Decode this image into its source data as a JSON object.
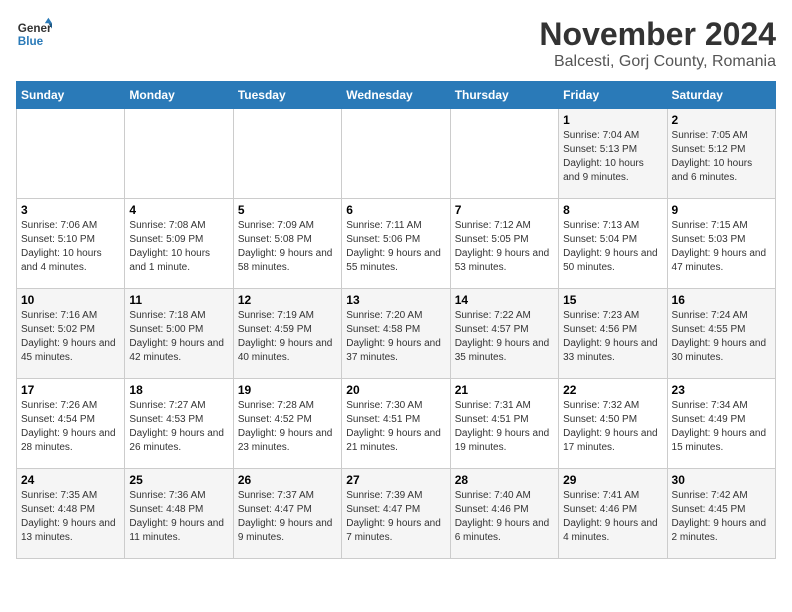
{
  "logo": {
    "line1": "General",
    "line2": "Blue"
  },
  "title": "November 2024",
  "subtitle": "Balcesti, Gorj County, Romania",
  "weekdays": [
    "Sunday",
    "Monday",
    "Tuesday",
    "Wednesday",
    "Thursday",
    "Friday",
    "Saturday"
  ],
  "weeks": [
    [
      {
        "day": "",
        "info": ""
      },
      {
        "day": "",
        "info": ""
      },
      {
        "day": "",
        "info": ""
      },
      {
        "day": "",
        "info": ""
      },
      {
        "day": "",
        "info": ""
      },
      {
        "day": "1",
        "info": "Sunrise: 7:04 AM\nSunset: 5:13 PM\nDaylight: 10 hours and 9 minutes."
      },
      {
        "day": "2",
        "info": "Sunrise: 7:05 AM\nSunset: 5:12 PM\nDaylight: 10 hours and 6 minutes."
      }
    ],
    [
      {
        "day": "3",
        "info": "Sunrise: 7:06 AM\nSunset: 5:10 PM\nDaylight: 10 hours and 4 minutes."
      },
      {
        "day": "4",
        "info": "Sunrise: 7:08 AM\nSunset: 5:09 PM\nDaylight: 10 hours and 1 minute."
      },
      {
        "day": "5",
        "info": "Sunrise: 7:09 AM\nSunset: 5:08 PM\nDaylight: 9 hours and 58 minutes."
      },
      {
        "day": "6",
        "info": "Sunrise: 7:11 AM\nSunset: 5:06 PM\nDaylight: 9 hours and 55 minutes."
      },
      {
        "day": "7",
        "info": "Sunrise: 7:12 AM\nSunset: 5:05 PM\nDaylight: 9 hours and 53 minutes."
      },
      {
        "day": "8",
        "info": "Sunrise: 7:13 AM\nSunset: 5:04 PM\nDaylight: 9 hours and 50 minutes."
      },
      {
        "day": "9",
        "info": "Sunrise: 7:15 AM\nSunset: 5:03 PM\nDaylight: 9 hours and 47 minutes."
      }
    ],
    [
      {
        "day": "10",
        "info": "Sunrise: 7:16 AM\nSunset: 5:02 PM\nDaylight: 9 hours and 45 minutes."
      },
      {
        "day": "11",
        "info": "Sunrise: 7:18 AM\nSunset: 5:00 PM\nDaylight: 9 hours and 42 minutes."
      },
      {
        "day": "12",
        "info": "Sunrise: 7:19 AM\nSunset: 4:59 PM\nDaylight: 9 hours and 40 minutes."
      },
      {
        "day": "13",
        "info": "Sunrise: 7:20 AM\nSunset: 4:58 PM\nDaylight: 9 hours and 37 minutes."
      },
      {
        "day": "14",
        "info": "Sunrise: 7:22 AM\nSunset: 4:57 PM\nDaylight: 9 hours and 35 minutes."
      },
      {
        "day": "15",
        "info": "Sunrise: 7:23 AM\nSunset: 4:56 PM\nDaylight: 9 hours and 33 minutes."
      },
      {
        "day": "16",
        "info": "Sunrise: 7:24 AM\nSunset: 4:55 PM\nDaylight: 9 hours and 30 minutes."
      }
    ],
    [
      {
        "day": "17",
        "info": "Sunrise: 7:26 AM\nSunset: 4:54 PM\nDaylight: 9 hours and 28 minutes."
      },
      {
        "day": "18",
        "info": "Sunrise: 7:27 AM\nSunset: 4:53 PM\nDaylight: 9 hours and 26 minutes."
      },
      {
        "day": "19",
        "info": "Sunrise: 7:28 AM\nSunset: 4:52 PM\nDaylight: 9 hours and 23 minutes."
      },
      {
        "day": "20",
        "info": "Sunrise: 7:30 AM\nSunset: 4:51 PM\nDaylight: 9 hours and 21 minutes."
      },
      {
        "day": "21",
        "info": "Sunrise: 7:31 AM\nSunset: 4:51 PM\nDaylight: 9 hours and 19 minutes."
      },
      {
        "day": "22",
        "info": "Sunrise: 7:32 AM\nSunset: 4:50 PM\nDaylight: 9 hours and 17 minutes."
      },
      {
        "day": "23",
        "info": "Sunrise: 7:34 AM\nSunset: 4:49 PM\nDaylight: 9 hours and 15 minutes."
      }
    ],
    [
      {
        "day": "24",
        "info": "Sunrise: 7:35 AM\nSunset: 4:48 PM\nDaylight: 9 hours and 13 minutes."
      },
      {
        "day": "25",
        "info": "Sunrise: 7:36 AM\nSunset: 4:48 PM\nDaylight: 9 hours and 11 minutes."
      },
      {
        "day": "26",
        "info": "Sunrise: 7:37 AM\nSunset: 4:47 PM\nDaylight: 9 hours and 9 minutes."
      },
      {
        "day": "27",
        "info": "Sunrise: 7:39 AM\nSunset: 4:47 PM\nDaylight: 9 hours and 7 minutes."
      },
      {
        "day": "28",
        "info": "Sunrise: 7:40 AM\nSunset: 4:46 PM\nDaylight: 9 hours and 6 minutes."
      },
      {
        "day": "29",
        "info": "Sunrise: 7:41 AM\nSunset: 4:46 PM\nDaylight: 9 hours and 4 minutes."
      },
      {
        "day": "30",
        "info": "Sunrise: 7:42 AM\nSunset: 4:45 PM\nDaylight: 9 hours and 2 minutes."
      }
    ]
  ]
}
